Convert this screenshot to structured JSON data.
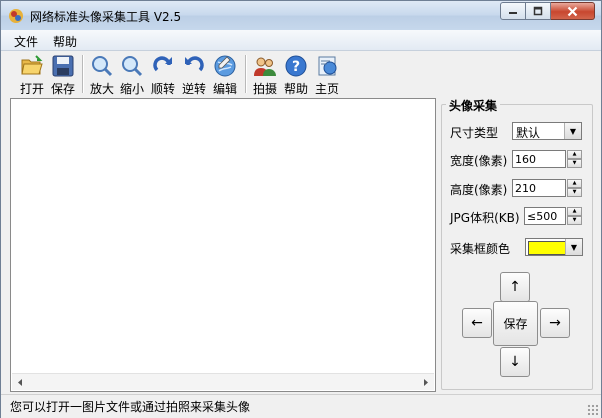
{
  "window": {
    "title": "网络标准头像采集工具 V2.5"
  },
  "menu": [
    {
      "label": "文件"
    },
    {
      "label": "帮助"
    }
  ],
  "toolbar": {
    "buttons": [
      {
        "label": "打开",
        "icon": "folder-open-icon"
      },
      {
        "label": "保存",
        "icon": "floppy-disk-icon"
      },
      {
        "label": "放大",
        "icon": "zoom-in-icon"
      },
      {
        "label": "缩小",
        "icon": "zoom-out-icon"
      },
      {
        "label": "顺转",
        "icon": "rotate-cw-icon"
      },
      {
        "label": "逆转",
        "icon": "rotate-ccw-icon"
      },
      {
        "label": "编辑",
        "icon": "edit-globe-icon"
      },
      {
        "label": "拍摄",
        "icon": "camera-people-icon"
      },
      {
        "label": "帮助",
        "icon": "help-icon"
      },
      {
        "label": "主页",
        "icon": "home-page-icon"
      }
    ]
  },
  "panel": {
    "title": "头像采集",
    "size_type": {
      "label": "尺寸类型",
      "value": "默认"
    },
    "width": {
      "label": "宽度(像素)",
      "value": "160"
    },
    "height": {
      "label": "高度(像素)",
      "value": "210"
    },
    "jpg_size": {
      "label": "JPG体积(KB)",
      "value": "≤500"
    },
    "frame_color": {
      "label": "采集框颜色",
      "color": "#ffff00"
    },
    "nav": {
      "up": "↑",
      "down": "↓",
      "left": "←",
      "right": "→",
      "save": "保存"
    }
  },
  "status": {
    "text": "您可以打开一图片文件或通过拍照来采集头像"
  }
}
